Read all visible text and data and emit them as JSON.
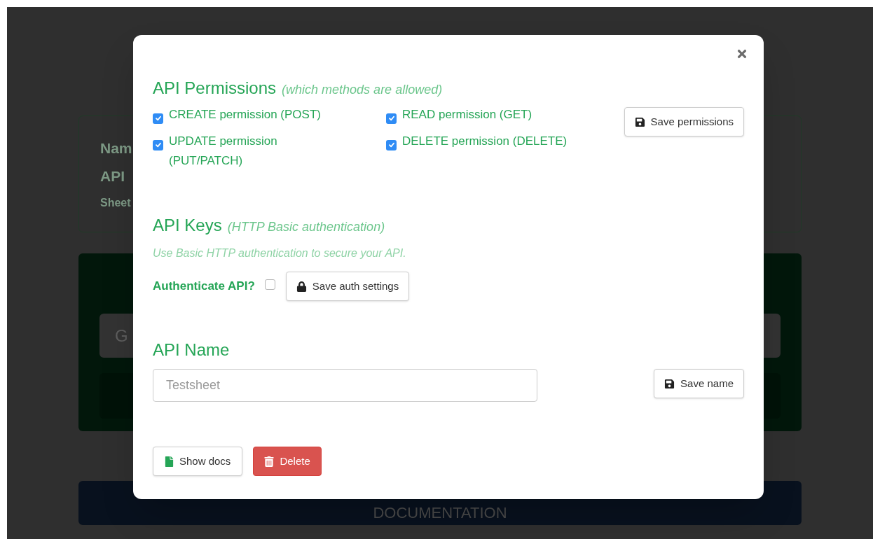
{
  "background": {
    "name_label": "Nam",
    "api_label": "API",
    "sheet_label": "Sheet",
    "input_placeholder": "G",
    "documentation_button": "DOCUMENTATION"
  },
  "modal": {
    "permissions": {
      "title": "API Permissions",
      "subtitle": "(which methods are allowed)",
      "save_button": "Save permissions",
      "items": [
        {
          "label": "CREATE permission (POST)",
          "checked": true
        },
        {
          "label": "READ permission (GET)",
          "checked": true
        },
        {
          "label": "UPDATE permission (PUT/PATCH)",
          "checked": true
        },
        {
          "label": "DELETE permission (DELETE)",
          "checked": true
        }
      ]
    },
    "keys": {
      "title": "API Keys",
      "subtitle": "(HTTP Basic authentication)",
      "hint": "Use Basic HTTP authentication to secure your API.",
      "auth_label": "Authenticate API?",
      "auth_checked": false,
      "save_button": "Save auth settings"
    },
    "name": {
      "title": "API Name",
      "placeholder": "Testsheet",
      "save_button": "Save name"
    },
    "footer": {
      "docs_button": "Show docs",
      "delete_button": "Delete"
    }
  }
}
